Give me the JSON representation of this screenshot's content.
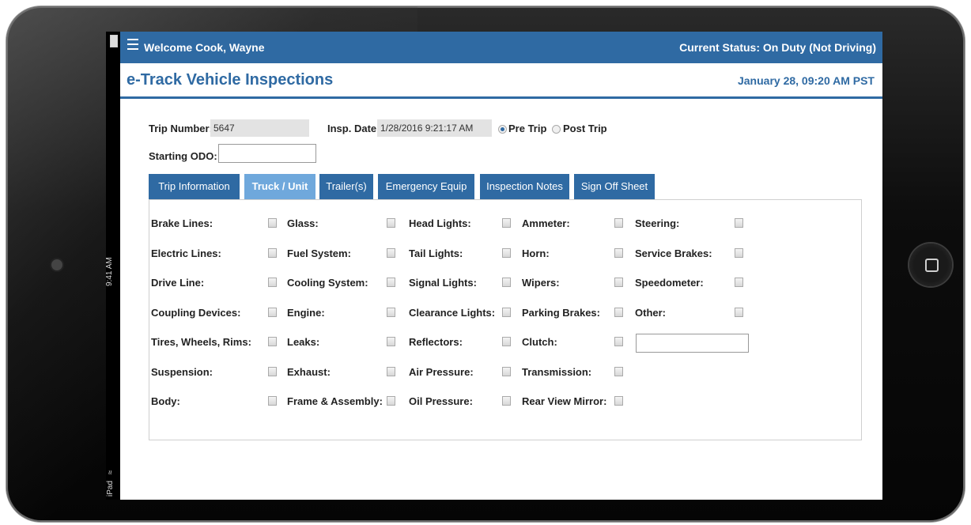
{
  "header": {
    "welcome": "Welcome Cook, Wayne",
    "status": "Current Status: On Duty (Not Driving)"
  },
  "title": {
    "app_title": "e-Track Vehicle Inspections",
    "date": "January 28, 09:20 AM PST"
  },
  "device": {
    "time": "9:41 AM",
    "carrier": "iPad"
  },
  "form": {
    "trip_number_label": "Trip Number:",
    "trip_number_value": "5647",
    "insp_date_label": "Insp. Date:",
    "insp_date_value": "1/28/2016 9:21:17 AM",
    "pre_trip_label": "Pre Trip",
    "post_trip_label": "Post Trip",
    "starting_odo_label": "Starting ODO:",
    "starting_odo_value": ""
  },
  "tabs": [
    {
      "label": "Trip Information"
    },
    {
      "label": "Truck / Unit"
    },
    {
      "label": "Trailer(s)"
    },
    {
      "label": "Emergency Equip"
    },
    {
      "label": "Inspection Notes"
    },
    {
      "label": "Sign Off Sheet"
    }
  ],
  "checklist": {
    "col1": [
      "Brake Lines:",
      "Electric Lines:",
      "Drive Line:",
      "Coupling Devices:",
      "Tires, Wheels, Rims:",
      "Suspension:",
      "Body:"
    ],
    "col2": [
      "Glass:",
      "Fuel System:",
      "Cooling System:",
      "Engine:",
      "Leaks:",
      "Exhaust:",
      "Frame & Assembly:"
    ],
    "col3": [
      "Head Lights:",
      "Tail Lights:",
      "Signal Lights:",
      "Clearance Lights:",
      "Reflectors:",
      "Air Pressure:",
      "Oil Pressure:"
    ],
    "col4": [
      "Ammeter:",
      "Horn:",
      "Wipers:",
      "Parking Brakes:",
      "Clutch:",
      "Transmission:",
      "Rear View Mirror:"
    ],
    "col5": [
      "Steering:",
      "Service Brakes:",
      "Speedometer:",
      "Other:"
    ]
  }
}
